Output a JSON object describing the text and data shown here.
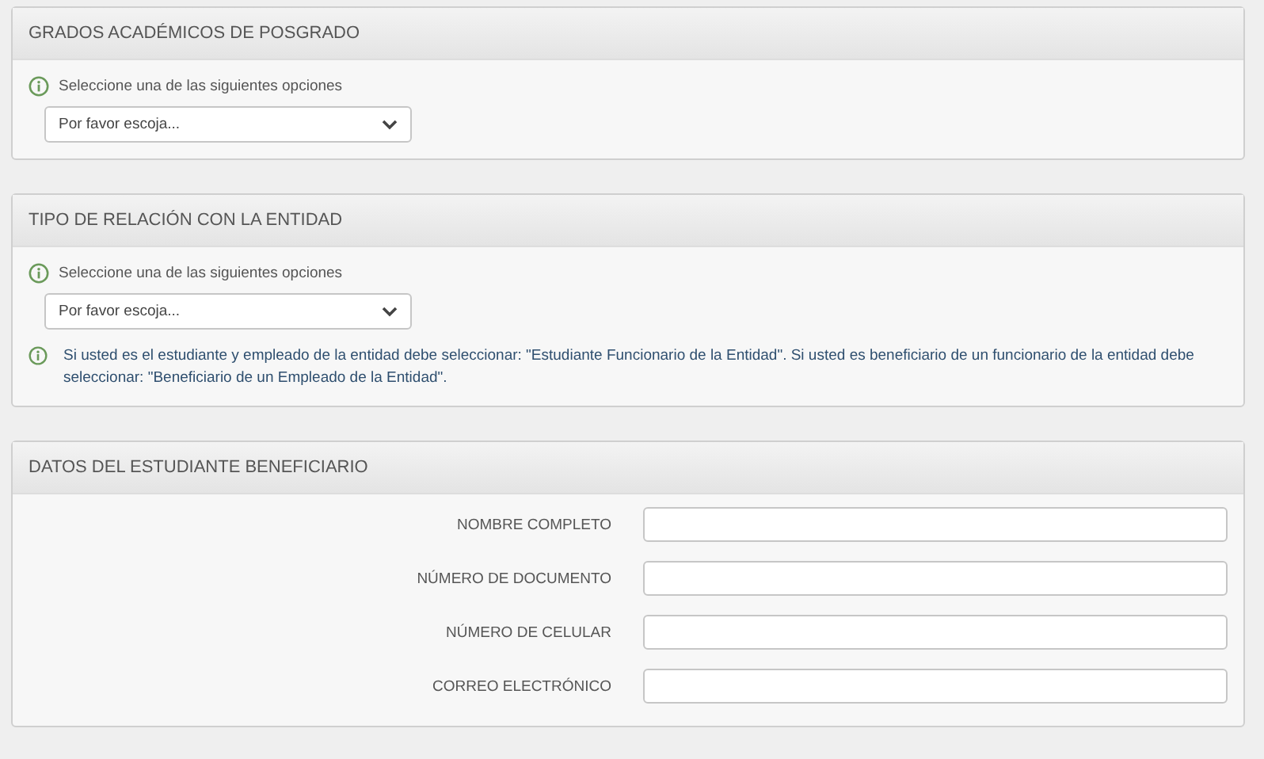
{
  "sections": [
    {
      "kind": "select",
      "title": "GRADOS ACADÉMICOS DE POSGRADO",
      "hint": "Seleccione una de las siguientes opciones",
      "select": {
        "value": "Por favor escoja..."
      }
    },
    {
      "kind": "select",
      "title": "TIPO DE RELACIÓN CON LA ENTIDAD",
      "hint": "Seleccione una de las siguientes opciones",
      "select": {
        "value": "Por favor escoja..."
      },
      "note": "Si usted es el estudiante y empleado de la entidad debe seleccionar: \"Estudiante Funcionario de la Entidad\". Si usted es beneficiario de un funcionario de la entidad debe seleccionar: \"Beneficiario de un Empleado de la Entidad\"."
    },
    {
      "kind": "form",
      "title": "DATOS DEL ESTUDIANTE BENEFICIARIO",
      "fields": [
        {
          "label": "NOMBRE COMPLETO"
        },
        {
          "label": "NÚMERO DE DOCUMENTO"
        },
        {
          "label": "NÚMERO DE CELULAR"
        },
        {
          "label": "CORREO ELECTRÓNICO"
        }
      ]
    }
  ]
}
